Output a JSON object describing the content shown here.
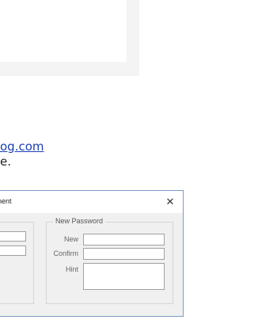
{
  "article": {
    "link_text": "og.com",
    "text_fragment": "e."
  },
  "dialog": {
    "title": "nent",
    "close_glyph": "✕",
    "new_password": {
      "group_title": "New Password",
      "new_label": "New",
      "confirm_label": "Confirm",
      "hint_label": "Hint",
      "new_value": "",
      "confirm_value": "",
      "hint_value": ""
    }
  }
}
